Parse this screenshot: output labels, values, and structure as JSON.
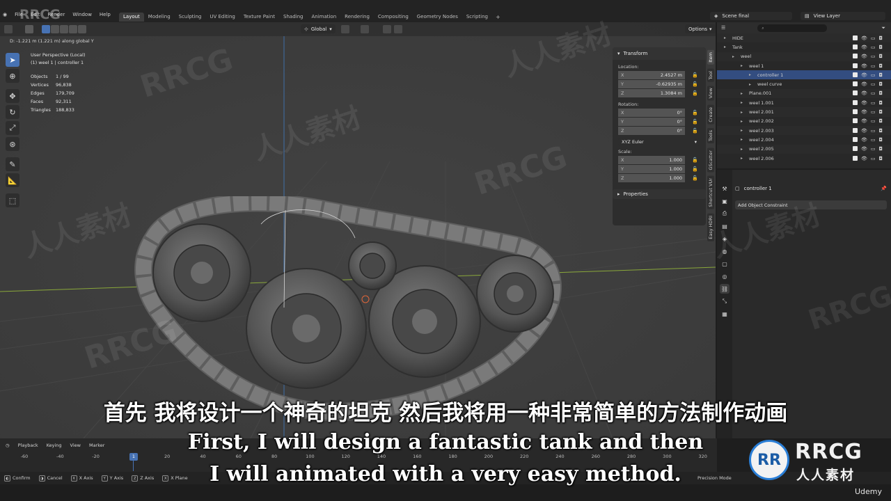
{
  "menu": [
    "File",
    "Edit",
    "Render",
    "Window",
    "Help"
  ],
  "workspaces": [
    "Layout",
    "Modeling",
    "Sculpting",
    "UV Editing",
    "Texture Paint",
    "Shading",
    "Animation",
    "Rendering",
    "Compositing",
    "Geometry Nodes",
    "Scripting"
  ],
  "active_workspace": "Layout",
  "scene_name": "Scene final",
  "view_layer": "View Layer",
  "viewport": {
    "orientation": "Global",
    "options_label": "Options",
    "status_line": "D: -1.221 m (1.221 m) along global Y",
    "perspective": "User Perspective (Local)",
    "active_object": "(1) weel 1 | controller 1",
    "stats": [
      {
        "k": "Objects",
        "v": "1 / 99"
      },
      {
        "k": "Vertices",
        "v": "96,838"
      },
      {
        "k": "Edges",
        "v": "179,709"
      },
      {
        "k": "Faces",
        "v": "92,311"
      },
      {
        "k": "Triangles",
        "v": "188,833"
      }
    ]
  },
  "transform": {
    "title": "Transform",
    "location_label": "Location:",
    "location": [
      {
        "ax": "X",
        "v": "2.4527 m"
      },
      {
        "ax": "Y",
        "v": "-0.62935 m"
      },
      {
        "ax": "Z",
        "v": "1.3084 m"
      }
    ],
    "rotation_label": "Rotation:",
    "rotation": [
      {
        "ax": "X",
        "v": "0°"
      },
      {
        "ax": "Y",
        "v": "0°"
      },
      {
        "ax": "Z",
        "v": "0°"
      }
    ],
    "rotation_mode": "XYZ Euler",
    "scale_label": "Scale:",
    "scale": [
      {
        "ax": "X",
        "v": "1.000"
      },
      {
        "ax": "Y",
        "v": "1.000"
      },
      {
        "ax": "Z",
        "v": "1.000"
      }
    ],
    "properties_label": "Properties"
  },
  "side_tabs": [
    "Item",
    "Tool",
    "View",
    "Create",
    "Tools",
    "GScatter",
    "Shortcut VUr",
    "Easy HDRI"
  ],
  "outliner": [
    {
      "name": "HIDE",
      "indent": 0
    },
    {
      "name": "Tank",
      "indent": 0
    },
    {
      "name": "weel",
      "indent": 1
    },
    {
      "name": "weel 1",
      "indent": 2
    },
    {
      "name": "controller 1",
      "indent": 3,
      "selected": true
    },
    {
      "name": "weel curve",
      "indent": 3
    },
    {
      "name": "Plane.001",
      "indent": 2
    },
    {
      "name": "weel 1.001",
      "indent": 2
    },
    {
      "name": "weel 2.001",
      "indent": 2
    },
    {
      "name": "weel 2.002",
      "indent": 2
    },
    {
      "name": "weel 2.003",
      "indent": 2
    },
    {
      "name": "weel 2.004",
      "indent": 2
    },
    {
      "name": "weel 2.005",
      "indent": 2
    },
    {
      "name": "weel 2.006",
      "indent": 2
    }
  ],
  "properties": {
    "object_name": "controller 1",
    "add_constraint": "Add Object Constraint"
  },
  "timeline": {
    "menus": [
      "Playback",
      "Keying",
      "View",
      "Marker"
    ],
    "ticks": [
      "-60",
      "-40",
      "-20",
      "1",
      "20",
      "40",
      "60",
      "80",
      "100",
      "120",
      "140",
      "160",
      "180",
      "200",
      "220",
      "240",
      "260",
      "280",
      "300",
      "320"
    ],
    "current_frame": "1"
  },
  "statusbar": [
    {
      "key": "",
      "label": "Confirm"
    },
    {
      "key": "",
      "label": "Cancel"
    },
    {
      "key": "X",
      "label": "X Axis"
    },
    {
      "key": "Y",
      "label": "Y Axis"
    },
    {
      "key": "Z",
      "label": "Z Axis"
    },
    {
      "key": "X",
      "label": "X Plane"
    }
  ],
  "status_right": "Precision Mode",
  "subtitle_cn": "首先 我将设计一个神奇的坦克 然后我将用一种非常简单的方法制作动画",
  "subtitle_en_1": "First, I will design a fantastic tank and then",
  "subtitle_en_2": "I will animated with a very easy method.",
  "watermark_small": "RRCG",
  "watermark_latin": "RRCG",
  "watermark_cn": "人人素材",
  "logo_mark": "RR",
  "logo_text": "RRCG",
  "logo_sub": "人人素材",
  "udemy": "Udemy",
  "colors": {
    "accent": "#4772b3",
    "selected_row": "#334d80",
    "viewport_bg": "#3d3d3d"
  }
}
